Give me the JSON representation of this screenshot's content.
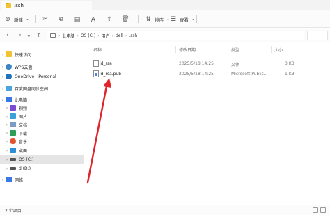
{
  "window": {
    "title": ".ssh"
  },
  "toolbar": {
    "new_label": "新建",
    "sort_label": "排序",
    "view_label": "查看",
    "more_label": "···"
  },
  "address": {
    "crumbs": [
      "此电脑",
      "OS (C:)",
      "用户",
      "dell",
      ".ssh"
    ]
  },
  "sidebar": {
    "items": [
      {
        "label": "快速访问",
        "icon": "star-icon",
        "color": "#f1c232"
      },
      {
        "label": "WPS云盘",
        "icon": "cloud-icon",
        "color": "#3d85c6"
      },
      {
        "label": "OneDrive - Personal",
        "icon": "onedrive-icon",
        "color": "#1e73be"
      },
      {
        "label": "百度网盘同步空间",
        "icon": "baidu-icon",
        "color": "#4aa3df"
      },
      {
        "label": "此电脑",
        "icon": "pc-icon",
        "color": "#3b78e7"
      },
      {
        "label": "视频",
        "icon": "video-icon",
        "color": "#7b4bd3"
      },
      {
        "label": "图片",
        "icon": "pictures-icon",
        "color": "#3aa0d8"
      },
      {
        "label": "文档",
        "icon": "documents-icon",
        "color": "#7a9cc6"
      },
      {
        "label": "下载",
        "icon": "download-icon",
        "color": "#2e9e57"
      },
      {
        "label": "音乐",
        "icon": "music-icon",
        "color": "#e2542e"
      },
      {
        "label": "桌面",
        "icon": "desktop-icon",
        "color": "#2d8fd5"
      },
      {
        "label": "OS (C:)",
        "icon": "drive-icon",
        "color": "#555555"
      },
      {
        "label": "d (D:)",
        "icon": "drive-icon",
        "color": "#555555"
      },
      {
        "label": "网络",
        "icon": "network-icon",
        "color": "#3b78e7"
      }
    ]
  },
  "columns": {
    "name": "名称",
    "date": "修改日期",
    "type": "类型",
    "size": "大小"
  },
  "files": [
    {
      "name": "id_rsa",
      "date": "2025/5/18 14:25",
      "type": "文件",
      "size": "3 KB",
      "icon": "file-icon"
    },
    {
      "name": "id_rsa.pub",
      "date": "2025/5/18 14:25",
      "type": "Microsoft Publis...",
      "size": "1 KB",
      "icon": "publisher-file-icon"
    }
  ],
  "status": {
    "text": "2 个项目"
  },
  "colors": {
    "accent": "#0067c0",
    "arrow": "#e0262d",
    "selected": "#e5e5e5"
  }
}
